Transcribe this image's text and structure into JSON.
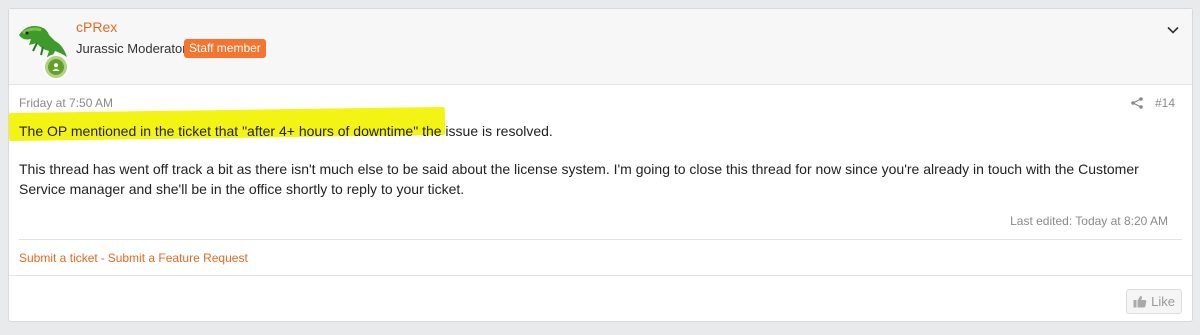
{
  "user": {
    "name": "cPRex",
    "title": "Jurassic Moderator",
    "badge": "Staff member"
  },
  "post": {
    "date": "Friday at 7:50 AM",
    "number": "#14",
    "paragraph1": "The OP mentioned in the ticket that \"after 4+ hours of downtime\" the issue is resolved.",
    "paragraph2": "This thread has went off track a bit as there isn't much else to be said about the license system. I'm going to close this thread for now since you're already in touch with the Customer Service manager and she'll be in the office shortly to reply to your ticket.",
    "last_edited": "Last edited: Today at 8:20 AM"
  },
  "signature": {
    "link1": "Submit a ticket",
    "separator": "-",
    "link2": "Submit a Feature Request"
  },
  "actions": {
    "like_label": "Like"
  },
  "colors": {
    "username": "#e36a22",
    "staff_badge": "#f47430",
    "highlight": "#f4f414",
    "online": "#63a12b"
  },
  "icons": [
    "dinosaur-avatar-icon",
    "online-status-icon",
    "chevron-down-icon",
    "share-icon",
    "thumbs-up-icon"
  ]
}
